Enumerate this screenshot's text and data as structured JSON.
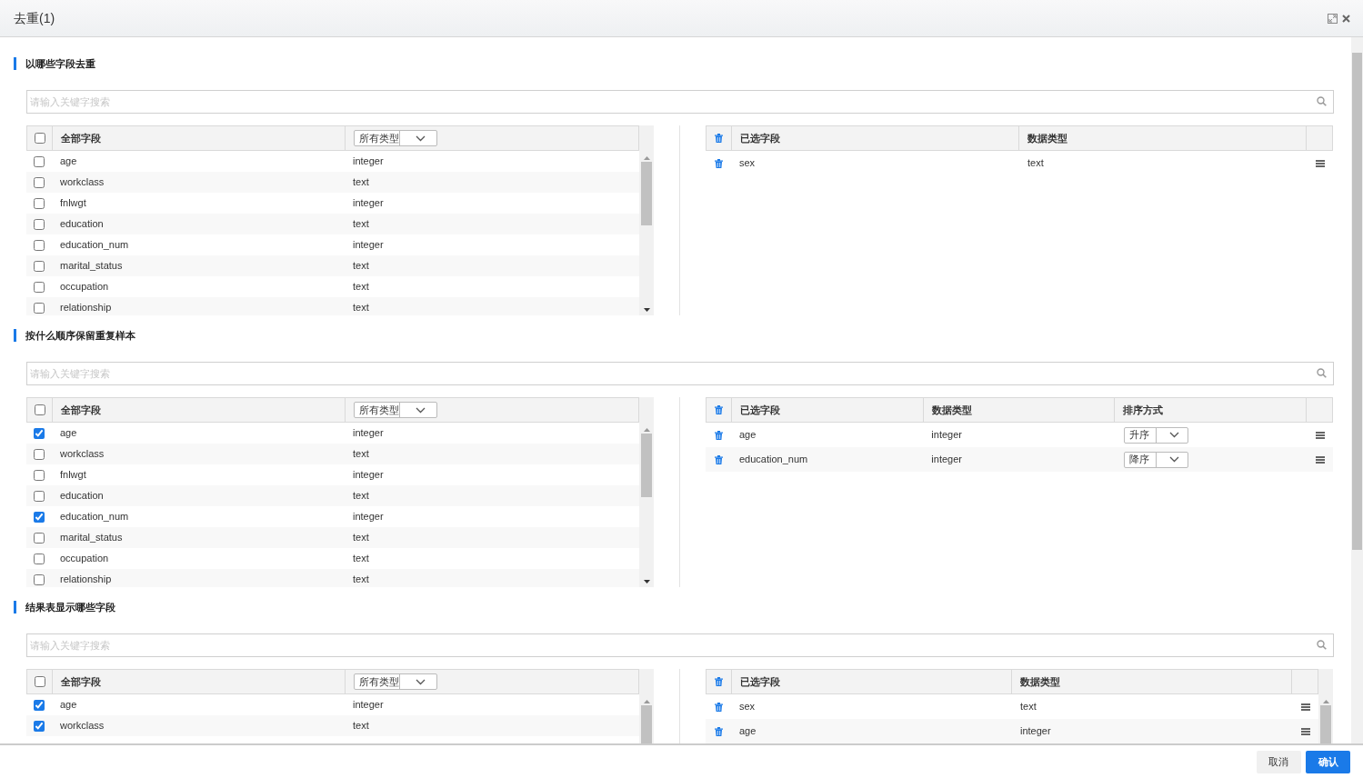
{
  "dialog": {
    "title": "去重(1)"
  },
  "sections": [
    {
      "title": "以哪些字段去重",
      "search": {
        "placeholder": "请输入关键字搜索"
      },
      "all_fields": {
        "header_checked": false,
        "column_label": "全部字段",
        "type_filter": "所有类型",
        "rows": [
          {
            "name": "age",
            "type": "integer",
            "checked": false
          },
          {
            "name": "workclass",
            "type": "text",
            "checked": false
          },
          {
            "name": "fnlwgt",
            "type": "integer",
            "checked": false
          },
          {
            "name": "education",
            "type": "text",
            "checked": false
          },
          {
            "name": "education_num",
            "type": "integer",
            "checked": false
          },
          {
            "name": "marital_status",
            "type": "text",
            "checked": false
          },
          {
            "name": "occupation",
            "type": "text",
            "checked": false
          },
          {
            "name": "relationship",
            "type": "text",
            "checked": false
          }
        ]
      },
      "selected_fields": {
        "columns": [
          "已选字段",
          "数据类型"
        ],
        "scrollable": false,
        "rows": [
          {
            "name": "sex",
            "type": "text"
          }
        ]
      }
    },
    {
      "title": "按什么顺序保留重复样本",
      "search": {
        "placeholder": "请输入关键字搜索"
      },
      "all_fields": {
        "header_checked": false,
        "column_label": "全部字段",
        "type_filter": "所有类型",
        "rows": [
          {
            "name": "age",
            "type": "integer",
            "checked": true
          },
          {
            "name": "workclass",
            "type": "text",
            "checked": false
          },
          {
            "name": "fnlwgt",
            "type": "integer",
            "checked": false
          },
          {
            "name": "education",
            "type": "text",
            "checked": false
          },
          {
            "name": "education_num",
            "type": "integer",
            "checked": true
          },
          {
            "name": "marital_status",
            "type": "text",
            "checked": false
          },
          {
            "name": "occupation",
            "type": "text",
            "checked": false
          },
          {
            "name": "relationship",
            "type": "text",
            "checked": false
          }
        ]
      },
      "selected_fields": {
        "columns": [
          "已选字段",
          "数据类型",
          "排序方式"
        ],
        "scrollable": false,
        "rows": [
          {
            "name": "age",
            "type": "integer",
            "order": "升序"
          },
          {
            "name": "education_num",
            "type": "integer",
            "order": "降序"
          }
        ]
      }
    },
    {
      "title": "结果表显示哪些字段",
      "search": {
        "placeholder": "请输入关键字搜索"
      },
      "all_fields": {
        "header_checked": false,
        "column_label": "全部字段",
        "type_filter": "所有类型",
        "rows": [
          {
            "name": "age",
            "type": "integer",
            "checked": true
          },
          {
            "name": "workclass",
            "type": "text",
            "checked": true
          }
        ]
      },
      "selected_fields": {
        "columns": [
          "已选字段",
          "数据类型"
        ],
        "scrollable": true,
        "rows": [
          {
            "name": "sex",
            "type": "text"
          },
          {
            "name": "age",
            "type": "integer"
          }
        ]
      }
    }
  ],
  "buttons": [
    {
      "label": "取消",
      "kind": "secondary"
    },
    {
      "label": "确认",
      "kind": "primary"
    }
  ]
}
